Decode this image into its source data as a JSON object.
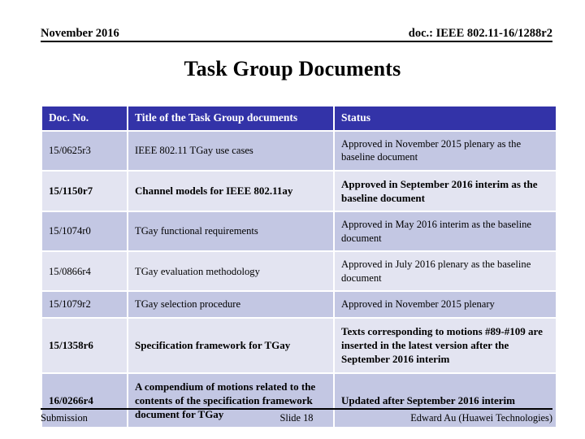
{
  "header": {
    "date": "November 2016",
    "doc_id": "doc.: IEEE 802.11-16/1288r2"
  },
  "title": "Task Group Documents",
  "colors": {
    "header_row_bg": "#3333a8",
    "header_row_text": "#ffffff",
    "row_shade_dark": "#c3c7e3",
    "row_shade_light": "#e3e4f1",
    "text": "#000000"
  },
  "table": {
    "columns": [
      {
        "key": "doc_no",
        "label": "Doc. No."
      },
      {
        "key": "title",
        "label": "Title of the Task Group documents"
      },
      {
        "key": "status",
        "label": "Status"
      }
    ],
    "rows": [
      {
        "doc_no": "15/0625r3",
        "title": "IEEE 802.11 TGay use cases",
        "status": "Approved in November 2015 plenary as the baseline document",
        "bold": false,
        "shade": "dark"
      },
      {
        "doc_no": "15/1150r7",
        "title": "Channel models for IEEE 802.11ay",
        "status": "Approved in September 2016 interim as the baseline document",
        "bold": true,
        "shade": "light"
      },
      {
        "doc_no": "15/1074r0",
        "title": "TGay functional requirements",
        "status": "Approved in May 2016 interim as the baseline document",
        "bold": false,
        "shade": "dark"
      },
      {
        "doc_no": "15/0866r4",
        "title": "TGay evaluation methodology",
        "status": "Approved in July 2016 plenary as the baseline document",
        "bold": false,
        "shade": "light"
      },
      {
        "doc_no": "15/1079r2",
        "title": "TGay selection procedure",
        "status": "Approved in November 2015 plenary",
        "bold": false,
        "shade": "dark"
      },
      {
        "doc_no": "15/1358r6",
        "title": "Specification framework for TGay",
        "status": "Texts corresponding to motions #89-#109 are inserted in the latest version after the September 2016 interim",
        "bold": true,
        "shade": "light"
      },
      {
        "doc_no": "16/0266r4",
        "title": "A compendium of motions related to the contents of the specification framework document for TGay",
        "status": "Updated after September 2016 interim",
        "bold": true,
        "shade": "dark"
      }
    ]
  },
  "footer": {
    "left": "Submission",
    "center": "Slide 18",
    "right": "Edward Au (Huawei Technologies)"
  }
}
